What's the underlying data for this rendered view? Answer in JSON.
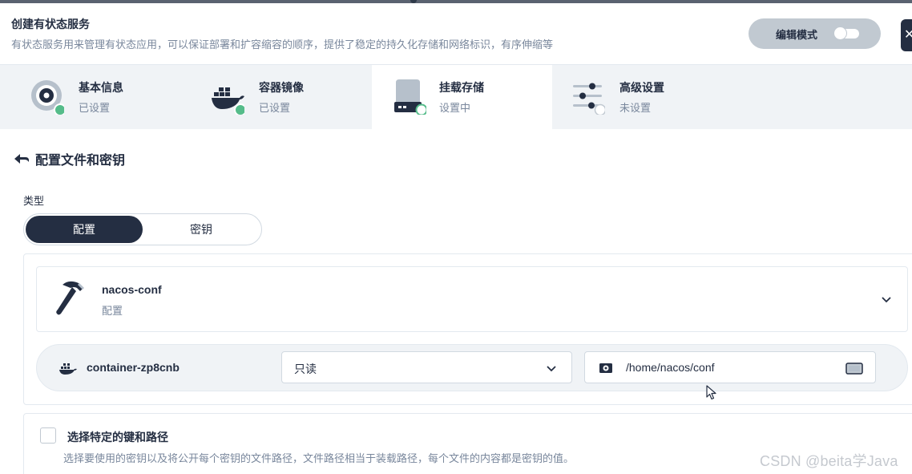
{
  "header": {
    "title": "创建有状态服务",
    "description": "有状态服务用来管理有状态应用，可以保证部署和扩容缩容的顺序，提供了稳定的持久化存储和网络标识，有序伸缩等",
    "edit_mode_label": "编辑模式"
  },
  "steps": [
    {
      "name": "基本信息",
      "status": "已设置",
      "icon": "disc-icon"
    },
    {
      "name": "容器镜像",
      "status": "已设置",
      "icon": "docker-icon"
    },
    {
      "name": "挂载存储",
      "status": "设置中",
      "icon": "storage-icon"
    },
    {
      "name": "高级设置",
      "status": "未设置",
      "icon": "sliders-icon"
    }
  ],
  "section": {
    "title": "配置文件和密钥"
  },
  "type": {
    "label": "类型",
    "options": [
      "配置",
      "密钥"
    ],
    "selected": "配置"
  },
  "config_item": {
    "name": "nacos-conf",
    "kind": "配置"
  },
  "mount": {
    "container": "container-zp8cnb",
    "access_mode": "只读",
    "path": "/home/nacos/conf"
  },
  "specific_keys": {
    "label": "选择特定的键和路径",
    "description": "选择要使用的密钥以及将公开每个密钥的文件路径，文件路径相当于装载路径，每个文件的内容都是密钥的值。"
  },
  "watermark": "CSDN @beita学Java",
  "colors": {
    "primary_dark": "#242e42",
    "muted_text": "#79879c",
    "success_green": "#55bc8a",
    "step_bg": "#f0f3f6"
  }
}
